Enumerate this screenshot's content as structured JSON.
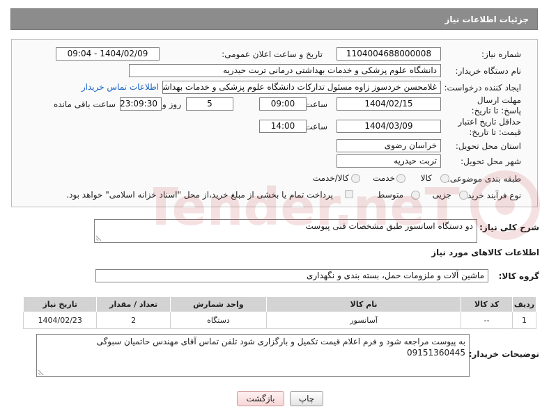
{
  "header": {
    "title": "جزئیات اطلاعات نیاز"
  },
  "form": {
    "need_number_label": "شماره نیاز:",
    "need_number": "1104004688000008",
    "announce_datetime_label": "تاریخ و ساعت اعلان عمومی:",
    "announce_datetime": "1404/02/09 - 09:04",
    "buyer_org_label": "نام دستگاه خریدار:",
    "buyer_org": "دانشگاه علوم پزشکی و خدمات بهداشتی درمانی تربت حیدریه",
    "creator_label": "ایجاد کننده درخواست:",
    "creator": "غلامحسن خردسوز زاوه مسئول تدارکات دانشگاه علوم پزشکی و خدمات بهداشتی",
    "contact_link": "اطلاعات تماس خریدار",
    "reply_deadline_label": "مهلت ارسال پاسخ: تا تاریخ:",
    "reply_date": "1404/02/15",
    "time_label": "ساعت",
    "reply_time": "09:00",
    "days_value": "5",
    "days_label": "روز و",
    "remaining_value": "23:09:30",
    "remaining_label": "ساعت باقی مانده",
    "price_validity_label": "حداقل تاریخ اعتبار قیمت: تا تاریخ:",
    "price_date": "1404/03/09",
    "price_time": "14:00",
    "delivery_province_label": "استان محل تحویل:",
    "delivery_province": "خراسان رضوی",
    "delivery_city_label": "شهر محل تحویل:",
    "delivery_city": "تربت حیدریه",
    "category_label": "طبقه بندی موضوعی:",
    "category_options": [
      "کالا",
      "خدمت",
      "کالا/خدمت"
    ],
    "purchase_type_label": "نوع فرآیند خرید :",
    "purchase_type_options": [
      "جزیی",
      "متوسط"
    ],
    "payment_note": "پرداخت تمام یا بخشی از مبلغ خرید،از محل \"اسناد خزانه اسلامی\" خواهد بود."
  },
  "description": {
    "label": "شرح کلی نیاز:",
    "value": "دو دستگاه اسانسور طبق مشخصات فنی پیوست"
  },
  "goods_section": {
    "title": "اطلاعات کالاهای مورد نیاز",
    "group_label": "گروه کالا:",
    "group_value": "ماشین آلات و ملزومات حمل، بسته بندی و نگهداری"
  },
  "table": {
    "columns": [
      "ردیف",
      "کد کالا",
      "نام کالا",
      "واحد شمارش",
      "تعداد / مقدار",
      "تاریخ نیاز"
    ],
    "rows": [
      [
        "1",
        "--",
        "آسانسور",
        "دستگاه",
        "2",
        "1404/02/23"
      ]
    ]
  },
  "buyer_notes": {
    "label": "توضیحات خریدار:",
    "value": "به پیوست مراجعه شود و فرم اعلام قیمت تکمیل  و بارگزاری شود تلفن تماس آقای مهندس حاتمیان سبوگی 09151360445"
  },
  "buttons": {
    "print": "چاپ",
    "back": "بازگشت"
  },
  "watermark": {
    "text": "AriaTender.neT"
  }
}
